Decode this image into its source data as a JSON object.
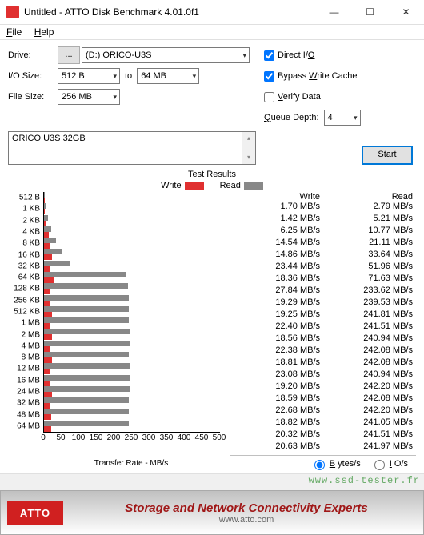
{
  "window": {
    "title": "Untitled - ATTO Disk Benchmark 4.01.0f1"
  },
  "menu": {
    "file": "File",
    "help": "Help"
  },
  "controls": {
    "drive_label": "Drive:",
    "drive_btn": "...",
    "drive_value": "(D:) ORICO-U3S",
    "io_label": "I/O Size:",
    "io_from": "512 B",
    "to": "to",
    "io_to": "64 MB",
    "fs_label": "File Size:",
    "fs_value": "256 MB",
    "direct_io": "Direct I/O",
    "bypass": "Bypass Write Cache",
    "verify": "Verify Data",
    "qd_label": "Queue Depth:",
    "qd_value": "4",
    "start": "Start",
    "textarea": "ORICO U3S 32GB"
  },
  "legend": {
    "title": "Test Results",
    "write": "Write",
    "read": "Read"
  },
  "axis": {
    "xlabel": "Transfer Rate - MB/s",
    "xticks": [
      "0",
      "50",
      "100",
      "150",
      "200",
      "250",
      "300",
      "350",
      "400",
      "450",
      "500"
    ]
  },
  "table": {
    "whdr": "Write",
    "rhdr": "Read"
  },
  "radios": {
    "bytes": "Bytes/s",
    "ios": "IO/s"
  },
  "footer": {
    "atto": "ATTO",
    "line1": "Storage and Network Connectivity Experts",
    "line2": "www.atto.com"
  },
  "watermark": "www.ssd-tester.fr",
  "chart_data": {
    "type": "bar",
    "xlabel": "Transfer Rate - MB/s",
    "xlim": [
      0,
      500
    ],
    "categories": [
      "512 B",
      "1 KB",
      "2 KB",
      "4 KB",
      "8 KB",
      "16 KB",
      "32 KB",
      "64 KB",
      "128 KB",
      "256 KB",
      "512 KB",
      "1 MB",
      "2 MB",
      "4 MB",
      "8 MB",
      "12 MB",
      "16 MB",
      "24 MB",
      "32 MB",
      "48 MB",
      "64 MB"
    ],
    "series": [
      {
        "name": "Write",
        "values": [
          1.7,
          1.42,
          6.25,
          14.54,
          14.86,
          23.44,
          18.36,
          27.84,
          19.29,
          19.25,
          22.4,
          18.56,
          22.38,
          18.81,
          23.08,
          19.2,
          18.59,
          22.68,
          18.82,
          20.32,
          20.63
        ],
        "labels": [
          "1.70 MB/s",
          "1.42 MB/s",
          "6.25 MB/s",
          "14.54 MB/s",
          "14.86 MB/s",
          "23.44 MB/s",
          "18.36 MB/s",
          "27.84 MB/s",
          "19.29 MB/s",
          "19.25 MB/s",
          "22.40 MB/s",
          "18.56 MB/s",
          "22.38 MB/s",
          "18.81 MB/s",
          "23.08 MB/s",
          "19.20 MB/s",
          "18.59 MB/s",
          "22.68 MB/s",
          "18.82 MB/s",
          "20.32 MB/s",
          "20.63 MB/s"
        ]
      },
      {
        "name": "Read",
        "values": [
          2.79,
          5.21,
          10.77,
          21.11,
          33.64,
          51.96,
          71.63,
          233.62,
          239.53,
          241.81,
          241.51,
          240.94,
          242.08,
          242.08,
          240.94,
          242.2,
          242.08,
          242.2,
          241.05,
          241.51,
          241.97
        ],
        "labels": [
          "2.79 MB/s",
          "5.21 MB/s",
          "10.77 MB/s",
          "21.11 MB/s",
          "33.64 MB/s",
          "51.96 MB/s",
          "71.63 MB/s",
          "233.62 MB/s",
          "239.53 MB/s",
          "241.81 MB/s",
          "241.51 MB/s",
          "240.94 MB/s",
          "242.08 MB/s",
          "242.08 MB/s",
          "240.94 MB/s",
          "242.20 MB/s",
          "242.08 MB/s",
          "242.20 MB/s",
          "241.05 MB/s",
          "241.51 MB/s",
          "241.97 MB/s"
        ]
      }
    ]
  }
}
